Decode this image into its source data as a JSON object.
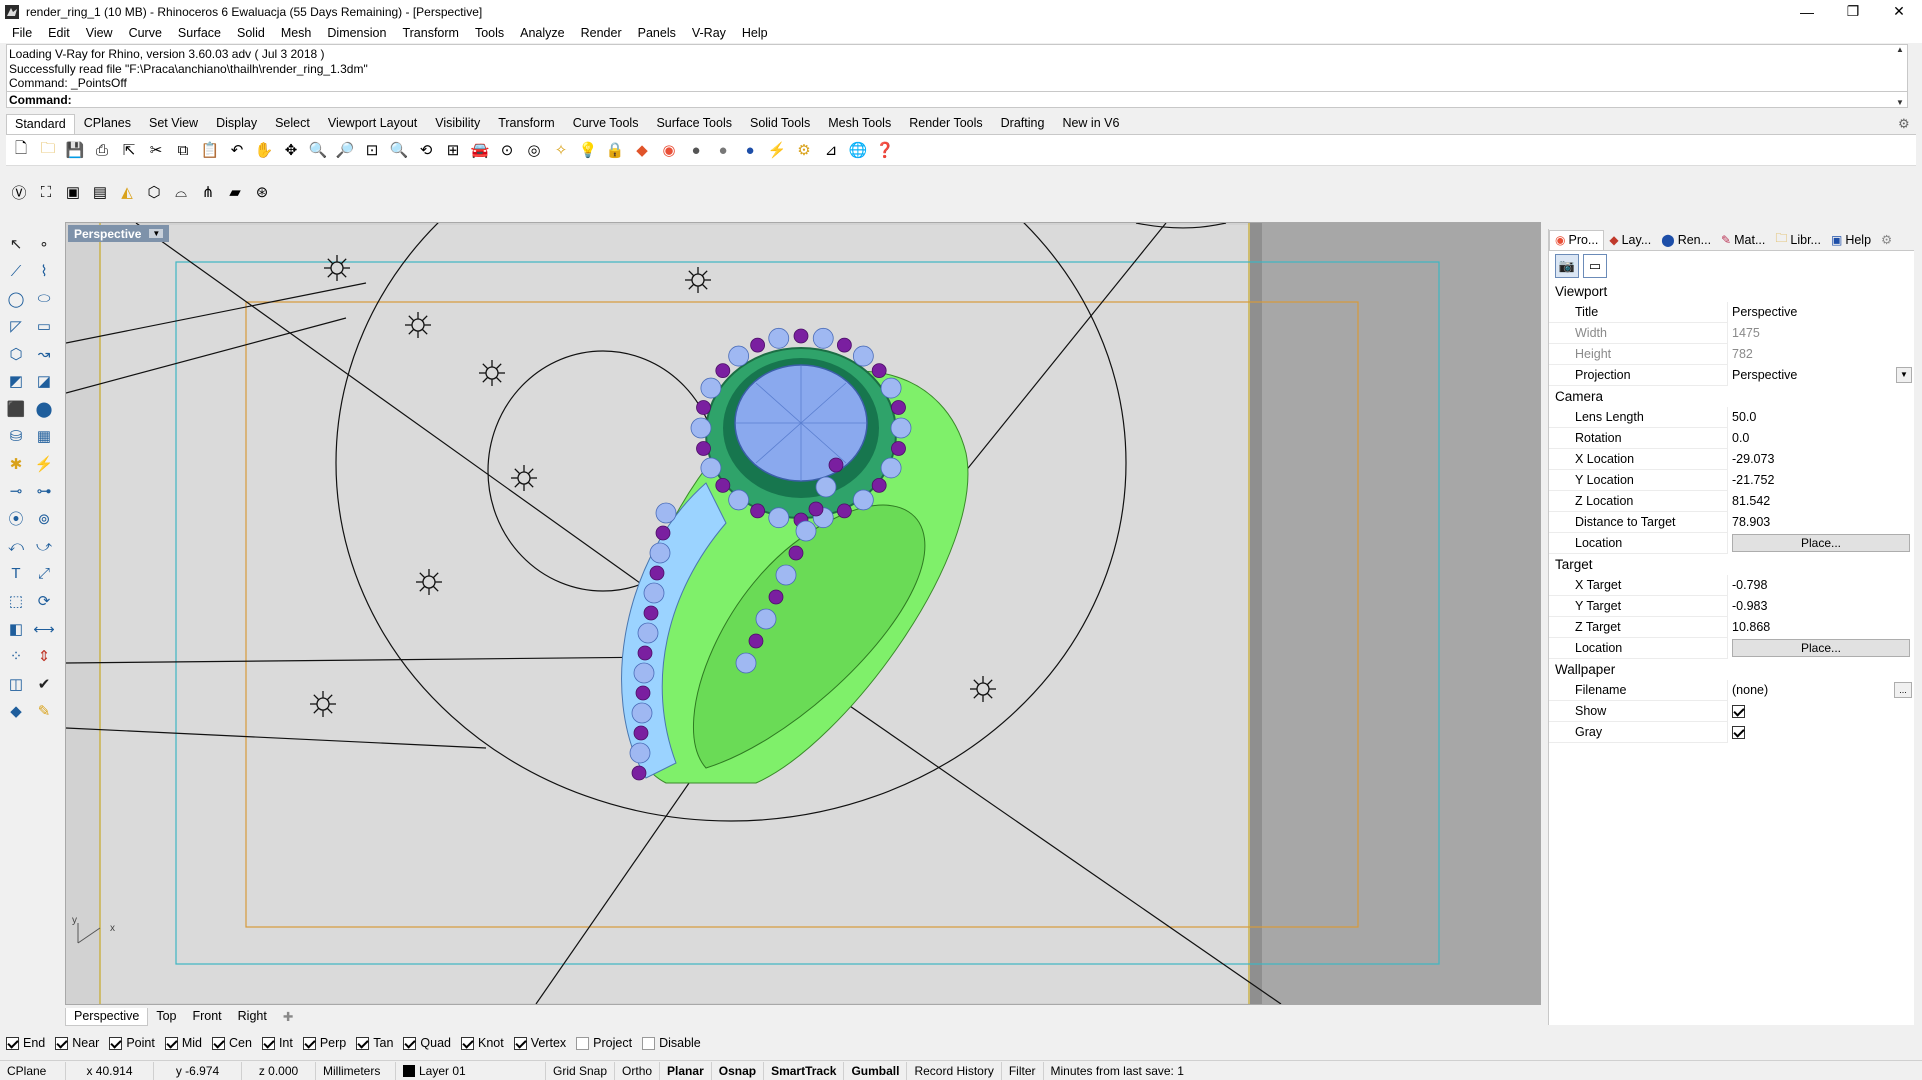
{
  "window": {
    "title": "render_ring_1 (10 MB) - Rhinoceros 6 Ewaluacja (55 Days Remaining) - [Perspective]",
    "minimize": "—",
    "restore": "❐",
    "close": "✕"
  },
  "menu": [
    "File",
    "Edit",
    "View",
    "Curve",
    "Surface",
    "Solid",
    "Mesh",
    "Dimension",
    "Transform",
    "Tools",
    "Analyze",
    "Render",
    "Panels",
    "V-Ray",
    "Help"
  ],
  "command": {
    "history": [
      "Loading V-Ray for Rhino, version 3.60.03 adv ( Jul  3 2018 )",
      "Successfully read file \"F:\\Praca\\anchiano\\thailh\\render_ring_1.3dm\"",
      "Command: _PointsOff"
    ],
    "prompt": "Command:",
    "value": ""
  },
  "toolbar_tabs": [
    "Standard",
    "CPlanes",
    "Set View",
    "Display",
    "Select",
    "Viewport Layout",
    "Visibility",
    "Transform",
    "Curve Tools",
    "Surface Tools",
    "Solid Tools",
    "Mesh Tools",
    "Render Tools",
    "Drafting",
    "New in V6"
  ],
  "viewport": {
    "title": "Perspective",
    "axis_x": "x",
    "axis_y": "y"
  },
  "viewport_tabs": [
    "Perspective",
    "Top",
    "Front",
    "Right"
  ],
  "osnap": [
    {
      "label": "End",
      "checked": true
    },
    {
      "label": "Near",
      "checked": true
    },
    {
      "label": "Point",
      "checked": true
    },
    {
      "label": "Mid",
      "checked": true
    },
    {
      "label": "Cen",
      "checked": true
    },
    {
      "label": "Int",
      "checked": true
    },
    {
      "label": "Perp",
      "checked": true
    },
    {
      "label": "Tan",
      "checked": true
    },
    {
      "label": "Quad",
      "checked": true
    },
    {
      "label": "Knot",
      "checked": true
    },
    {
      "label": "Vertex",
      "checked": true
    },
    {
      "label": "Project",
      "checked": false
    },
    {
      "label": "Disable",
      "checked": false
    }
  ],
  "status": {
    "cplane": "CPlane",
    "x": "x 40.914",
    "y": "y -6.974",
    "z": "z 0.000",
    "units": "Millimeters",
    "layer": "Layer 01",
    "grid_snap": "Grid Snap",
    "ortho": "Ortho",
    "planar": "Planar",
    "osnap": "Osnap",
    "smarttrack": "SmartTrack",
    "gumball": "Gumball",
    "record_history": "Record History",
    "filter": "Filter",
    "minutes": "Minutes from last save: 1"
  },
  "panel_tabs": [
    "Pro...",
    "Lay...",
    "Ren...",
    "Mat...",
    "Libr...",
    "Help"
  ],
  "properties": {
    "viewport_header": "Viewport",
    "title_label": "Title",
    "title_value": "Perspective",
    "width_label": "Width",
    "width_value": "1475",
    "height_label": "Height",
    "height_value": "782",
    "projection_label": "Projection",
    "projection_value": "Perspective",
    "camera_header": "Camera",
    "lens_label": "Lens Length",
    "lens_value": "50.0",
    "rotation_label": "Rotation",
    "rotation_value": "0.0",
    "xloc_label": "X Location",
    "xloc_value": "-29.073",
    "yloc_label": "Y Location",
    "yloc_value": "-21.752",
    "zloc_label": "Z Location",
    "zloc_value": "81.542",
    "dist_label": "Distance to Target",
    "dist_value": "78.903",
    "location_label": "Location",
    "place_button": "Place...",
    "target_header": "Target",
    "xt_label": "X Target",
    "xt_value": "-0.798",
    "yt_label": "Y Target",
    "yt_value": "-0.983",
    "zt_label": "Z Target",
    "zt_value": "10.868",
    "tlocation_label": "Location",
    "tplace_button": "Place...",
    "wallpaper_header": "Wallpaper",
    "filename_label": "Filename",
    "filename_value": "(none)",
    "show_label": "Show",
    "gray_label": "Gray"
  }
}
